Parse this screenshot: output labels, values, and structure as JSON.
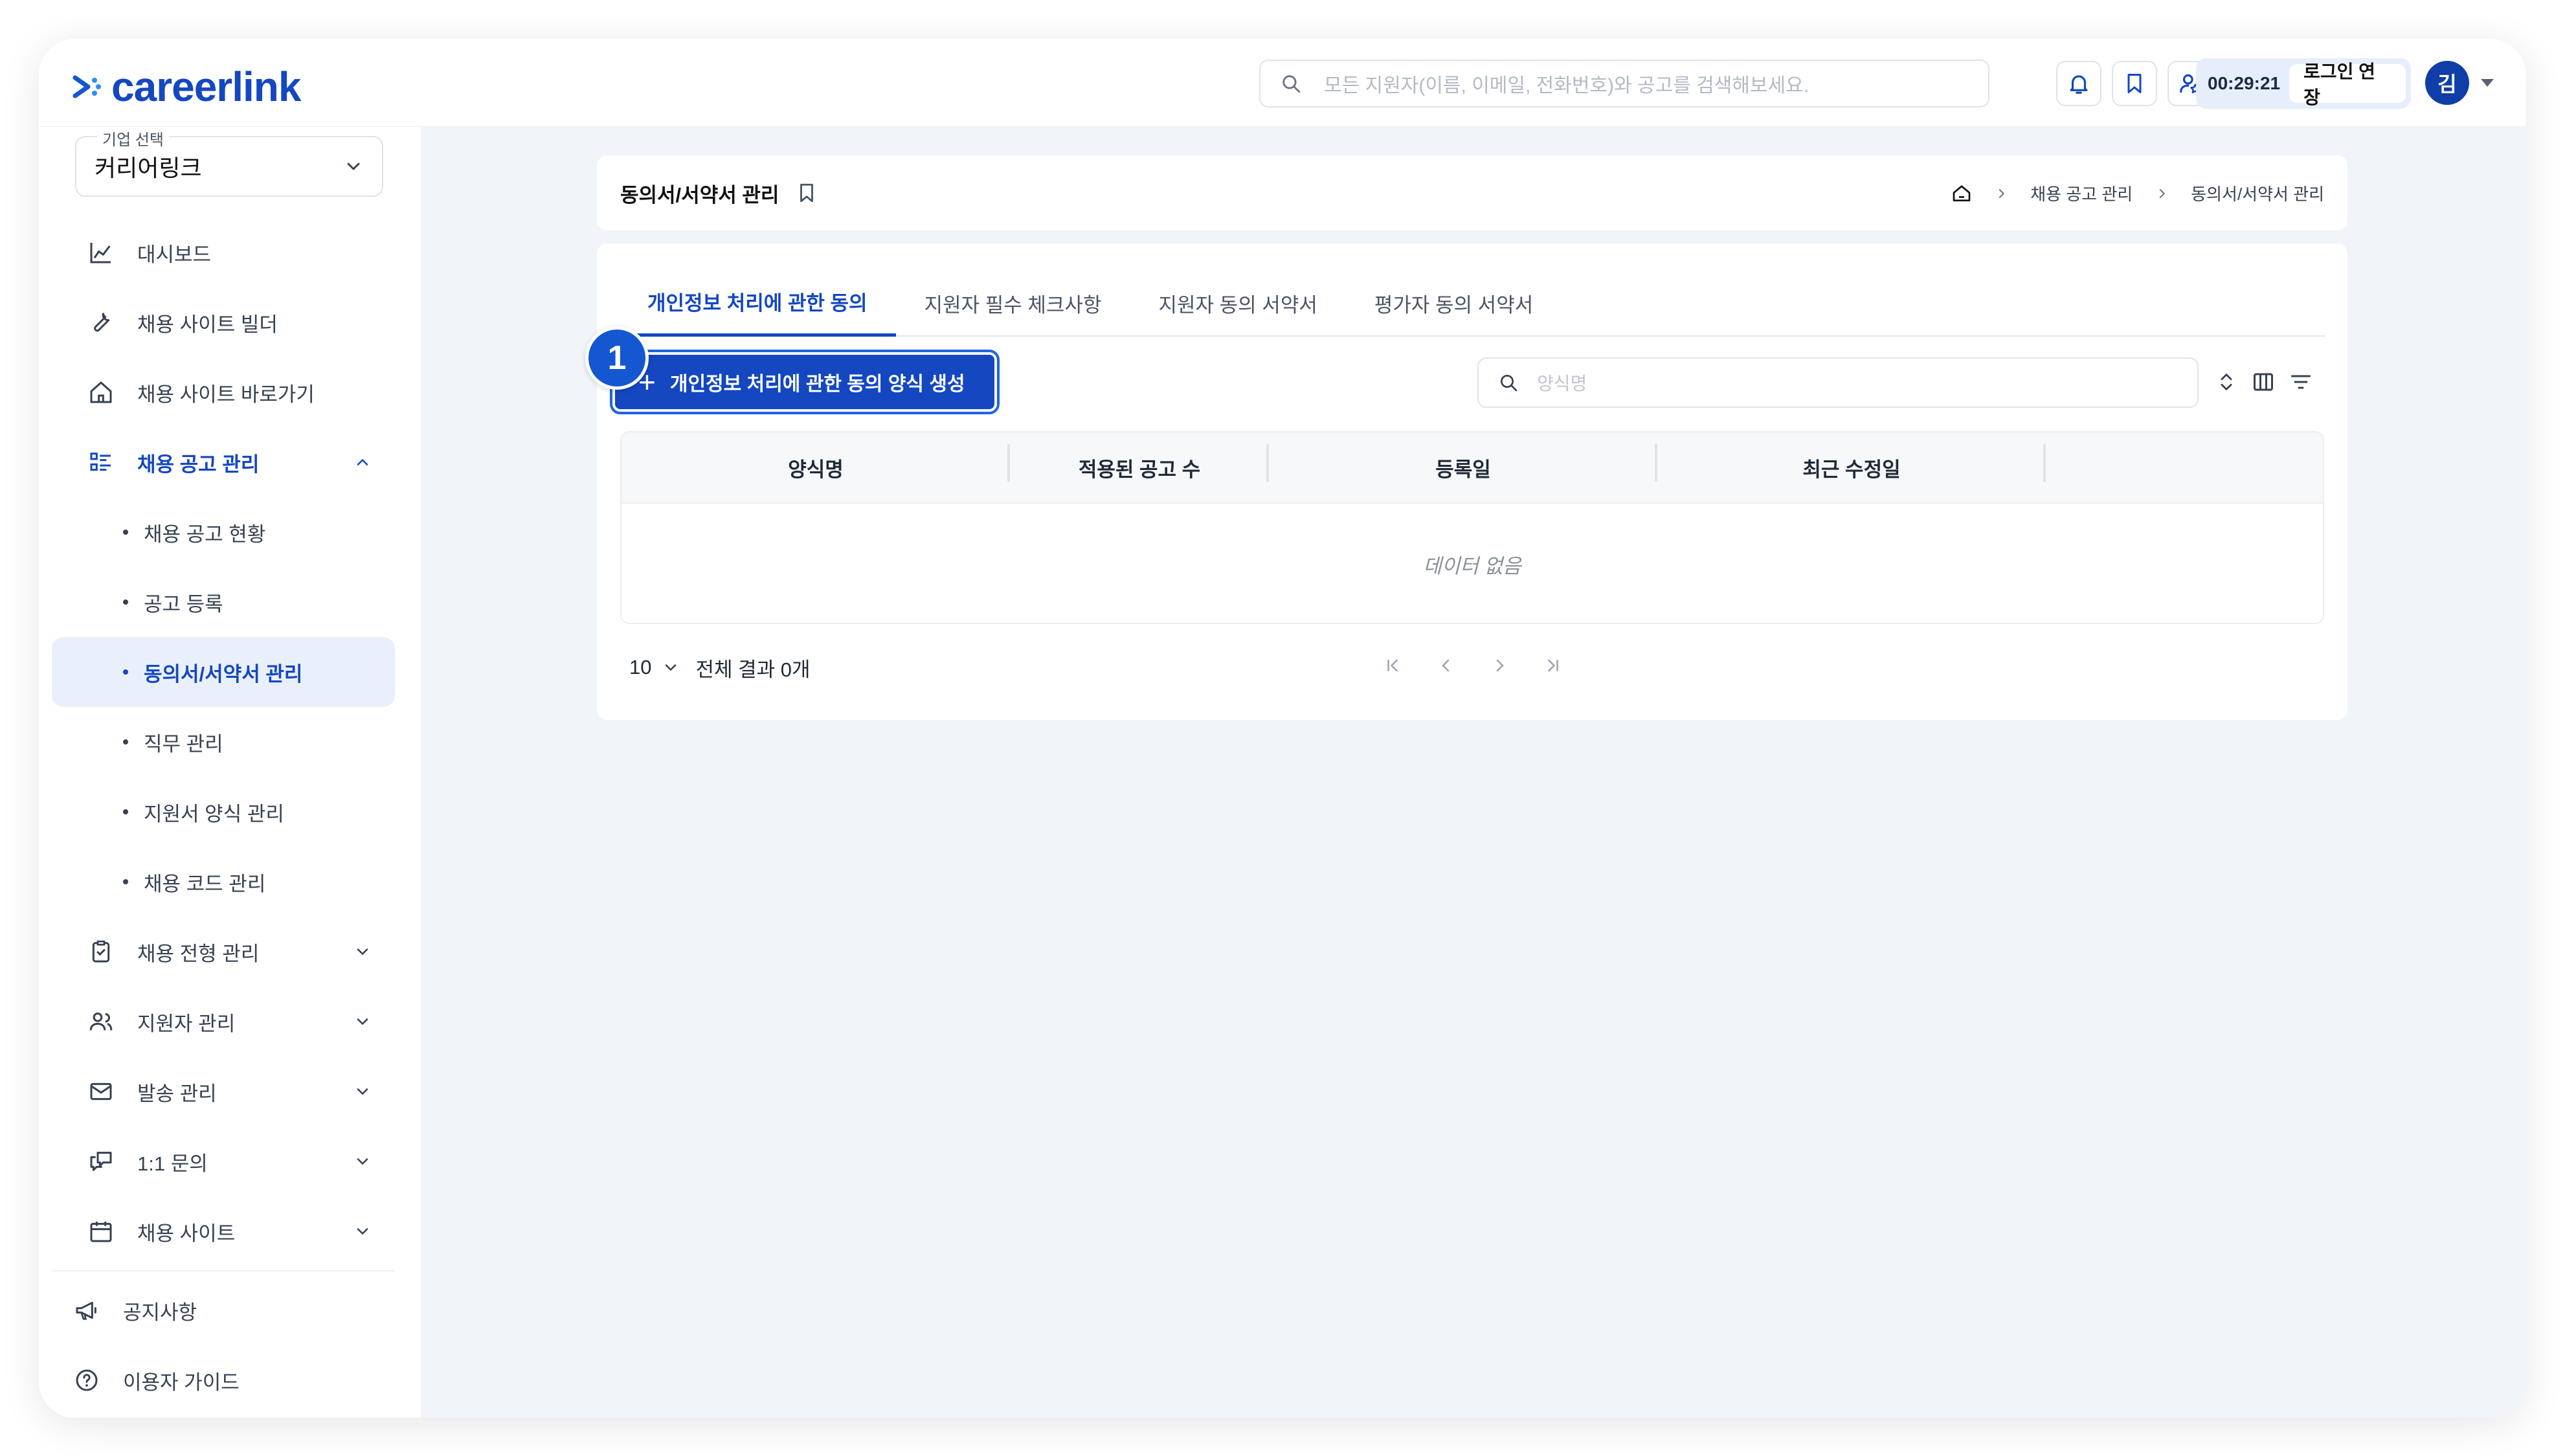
{
  "header": {
    "logo_text": "careerlink",
    "search_placeholder": "모든 지원자(이름, 이메일, 전화번호)와 공고를 검색해보세요.",
    "icons": [
      "bell-icon",
      "bookmark-icon",
      "user-settings-icon"
    ],
    "session_time": "00:29:21",
    "extend_label": "로그인 연장",
    "avatar_initial": "김"
  },
  "sidebar": {
    "company_label": "기업 선택",
    "company_value": "커리어링크",
    "items": [
      {
        "label": "대시보드",
        "icon": "chart-icon"
      },
      {
        "label": "채용 사이트 빌더",
        "icon": "wrench-icon"
      },
      {
        "label": "채용 사이트 바로가기",
        "icon": "home-icon"
      },
      {
        "label": "채용 공고 관리",
        "icon": "list-icon",
        "expanded": true
      },
      {
        "label": "채용 전형 관리",
        "icon": "clipboard-icon"
      },
      {
        "label": "지원자 관리",
        "icon": "users-icon"
      },
      {
        "label": "발송 관리",
        "icon": "mail-icon"
      },
      {
        "label": "1:1 문의",
        "icon": "chat-icon"
      },
      {
        "label": "채용 사이트",
        "icon": "calendar-icon"
      }
    ],
    "subitems": [
      {
        "label": "채용 공고 현황"
      },
      {
        "label": "공고 등록"
      },
      {
        "label": "동의서/서약서 관리",
        "active": true
      },
      {
        "label": "직무 관리"
      },
      {
        "label": "지원서 양식 관리"
      },
      {
        "label": "채용 코드 관리"
      }
    ],
    "footer": [
      {
        "label": "공지사항",
        "icon": "megaphone-icon"
      },
      {
        "label": "이용자 가이드",
        "icon": "help-icon"
      }
    ]
  },
  "page": {
    "title": "동의서/서약서 관리",
    "breadcrumb": [
      "채용 공고 관리",
      "동의서/서약서 관리"
    ]
  },
  "tabs": [
    {
      "label": "개인정보 처리에 관한 동의",
      "active": true
    },
    {
      "label": "지원자 필수 체크사항"
    },
    {
      "label": "지원자 동의 서약서"
    },
    {
      "label": "평가자 동의 서약서"
    }
  ],
  "step_badge": "1",
  "create_button": "개인정보 처리에 관한 동의 양식 생성",
  "filter_placeholder": "양식명",
  "table": {
    "columns": [
      "양식명",
      "적용된 공고 수",
      "등록일",
      "최근 수정일"
    ],
    "empty_text": "데이터 없음"
  },
  "pagination": {
    "page_size": "10",
    "total_text": "전체 결과 0개"
  },
  "colors": {
    "brand": "#1447c0",
    "accent": "#1557d0",
    "background": "#f1f4f9"
  }
}
